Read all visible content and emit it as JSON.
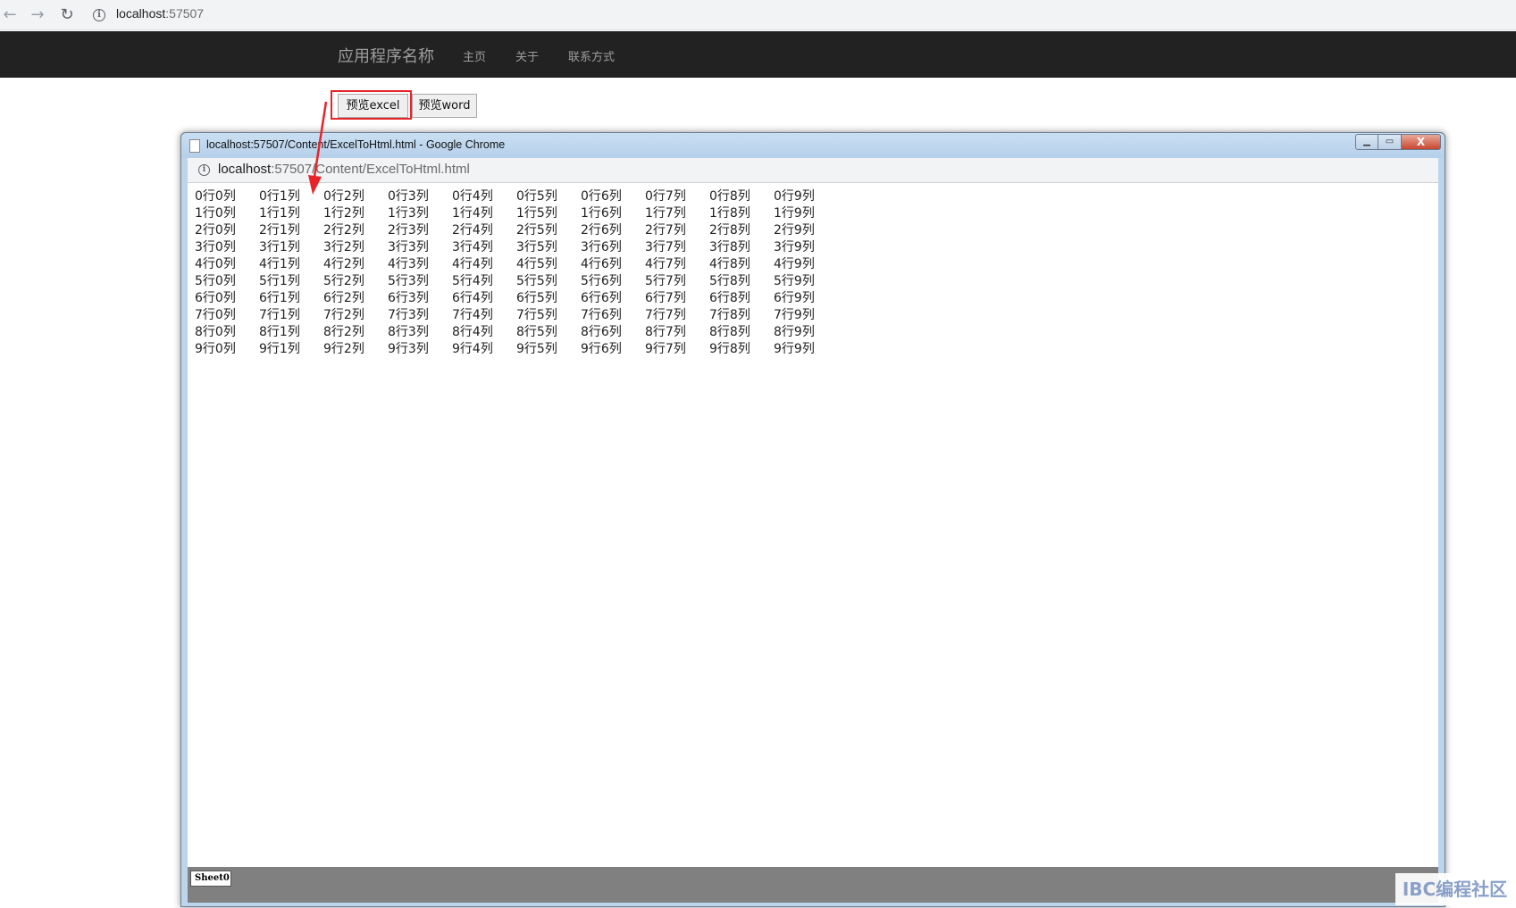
{
  "browser": {
    "url_host": "localhost",
    "url_port": ":57507"
  },
  "navbar": {
    "brand": "应用程序名称",
    "links": [
      "主页",
      "关于",
      "联系方式"
    ]
  },
  "buttons": {
    "excel_label": "预览excel",
    "word_label": "预览word"
  },
  "popup": {
    "title": "localhost:57507/Content/ExcelToHtml.html - Google Chrome",
    "url_host": "localhost",
    "url_rest": ":57507/Content/ExcelToHtml.html",
    "close_glyph": "X",
    "grid": [
      [
        "0行0列",
        "0行1列",
        "0行2列",
        "0行3列",
        "0行4列",
        "0行5列",
        "0行6列",
        "0行7列",
        "0行8列",
        "0行9列"
      ],
      [
        "1行0列",
        "1行1列",
        "1行2列",
        "1行3列",
        "1行4列",
        "1行5列",
        "1行6列",
        "1行7列",
        "1行8列",
        "1行9列"
      ],
      [
        "2行0列",
        "2行1列",
        "2行2列",
        "2行3列",
        "2行4列",
        "2行5列",
        "2行6列",
        "2行7列",
        "2行8列",
        "2行9列"
      ],
      [
        "3行0列",
        "3行1列",
        "3行2列",
        "3行3列",
        "3行4列",
        "3行5列",
        "3行6列",
        "3行7列",
        "3行8列",
        "3行9列"
      ],
      [
        "4行0列",
        "4行1列",
        "4行2列",
        "4行3列",
        "4行4列",
        "4行5列",
        "4行6列",
        "4行7列",
        "4行8列",
        "4行9列"
      ],
      [
        "5行0列",
        "5行1列",
        "5行2列",
        "5行3列",
        "5行4列",
        "5行5列",
        "5行6列",
        "5行7列",
        "5行8列",
        "5行9列"
      ],
      [
        "6行0列",
        "6行1列",
        "6行2列",
        "6行3列",
        "6行4列",
        "6行5列",
        "6行6列",
        "6行7列",
        "6行8列",
        "6行9列"
      ],
      [
        "7行0列",
        "7行1列",
        "7行2列",
        "7行3列",
        "7行4列",
        "7行5列",
        "7行6列",
        "7行7列",
        "7行8列",
        "7行9列"
      ],
      [
        "8行0列",
        "8行1列",
        "8行2列",
        "8行3列",
        "8行4列",
        "8行5列",
        "8行6列",
        "8行7列",
        "8行8列",
        "8行9列"
      ],
      [
        "9行0列",
        "9行1列",
        "9行2列",
        "9行3列",
        "9行4列",
        "9行5列",
        "9行6列",
        "9行7列",
        "9行8列",
        "9行9列"
      ]
    ],
    "sheet_tab": "Sheet0"
  },
  "annotation": {
    "color": "#e8242b"
  },
  "watermark": "IBC编程社区"
}
